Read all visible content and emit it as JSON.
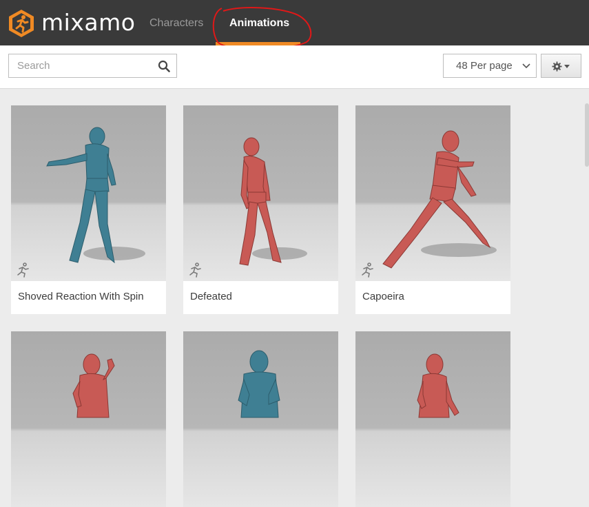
{
  "app": {
    "brand": "mixamo",
    "nav": {
      "characters": "Characters",
      "animations": "Animations"
    },
    "accent_color": "#f08a24"
  },
  "toolbar": {
    "search_placeholder": "Search",
    "per_page": "48 Per page"
  },
  "cards": [
    {
      "title": "Shoved Reaction With Spin",
      "color": "teal"
    },
    {
      "title": "Defeated",
      "color": "red"
    },
    {
      "title": "Capoeira",
      "color": "red"
    },
    {
      "title": "",
      "color": "red"
    },
    {
      "title": "",
      "color": "teal"
    },
    {
      "title": "",
      "color": "red"
    }
  ],
  "icons": {
    "logo": "mixamo-logo-icon",
    "search": "search-icon",
    "dropdown": "chevron-down-icon",
    "settings": "gear-icon",
    "animation_badge": "running-figure-icon"
  }
}
